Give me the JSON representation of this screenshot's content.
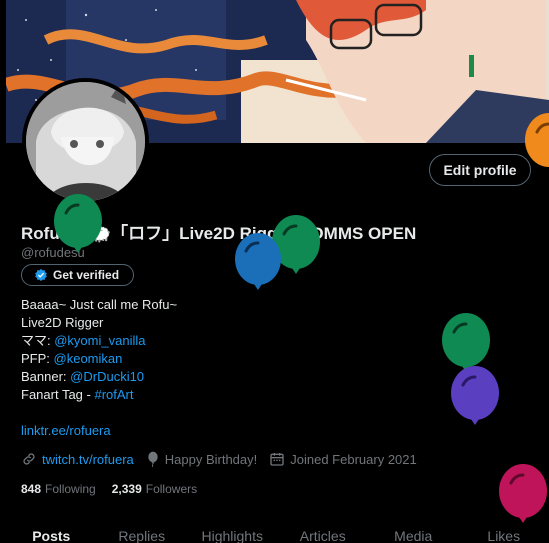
{
  "profile": {
    "display_name": "Rofuera 🐑「ロフ」Live2D Rigger COMMS OPEN",
    "handle": "@rofudesu",
    "edit_label": "Edit profile",
    "verify_label": "Get verified"
  },
  "bio": {
    "line1": "Baaaa~ Just call me Rofu~",
    "line2": "Live2D Rigger",
    "mama_prefix": "ママ: ",
    "mama_link": "@kyomi_vanilla",
    "pfp_prefix": "PFP: ",
    "pfp_link": "@keomikan",
    "banner_prefix": "Banner: ",
    "banner_link": "@DrDucki10",
    "fanart_prefix": "Fanart Tag - ",
    "fanart_link": "#rofArt",
    "website": "linktr.ee/rofuera"
  },
  "meta": {
    "url": "twitch.tv/rofuera",
    "birthday": "Happy Birthday!",
    "joined": "Joined February 2021"
  },
  "stats": {
    "following_count": "848",
    "following_label": "Following",
    "followers_count": "2,339",
    "followers_label": "Followers"
  },
  "tabs": [
    "Posts",
    "Replies",
    "Highlights",
    "Articles",
    "Media",
    "Likes"
  ],
  "active_tab": "Posts",
  "colors": {
    "background": "#000000",
    "accent": "#1d9bf0",
    "text": "#e7e9ea",
    "muted": "#71767b",
    "balloon_green": "#0f8a52",
    "balloon_blue": "#1a6fb8",
    "balloon_purple": "#5a3fc0",
    "balloon_magenta": "#c0145a",
    "balloon_orange": "#f08a1c"
  },
  "icons": [
    "verified-badge-icon",
    "link-icon",
    "balloon-icon",
    "calendar-icon",
    "balloon-decoration"
  ]
}
